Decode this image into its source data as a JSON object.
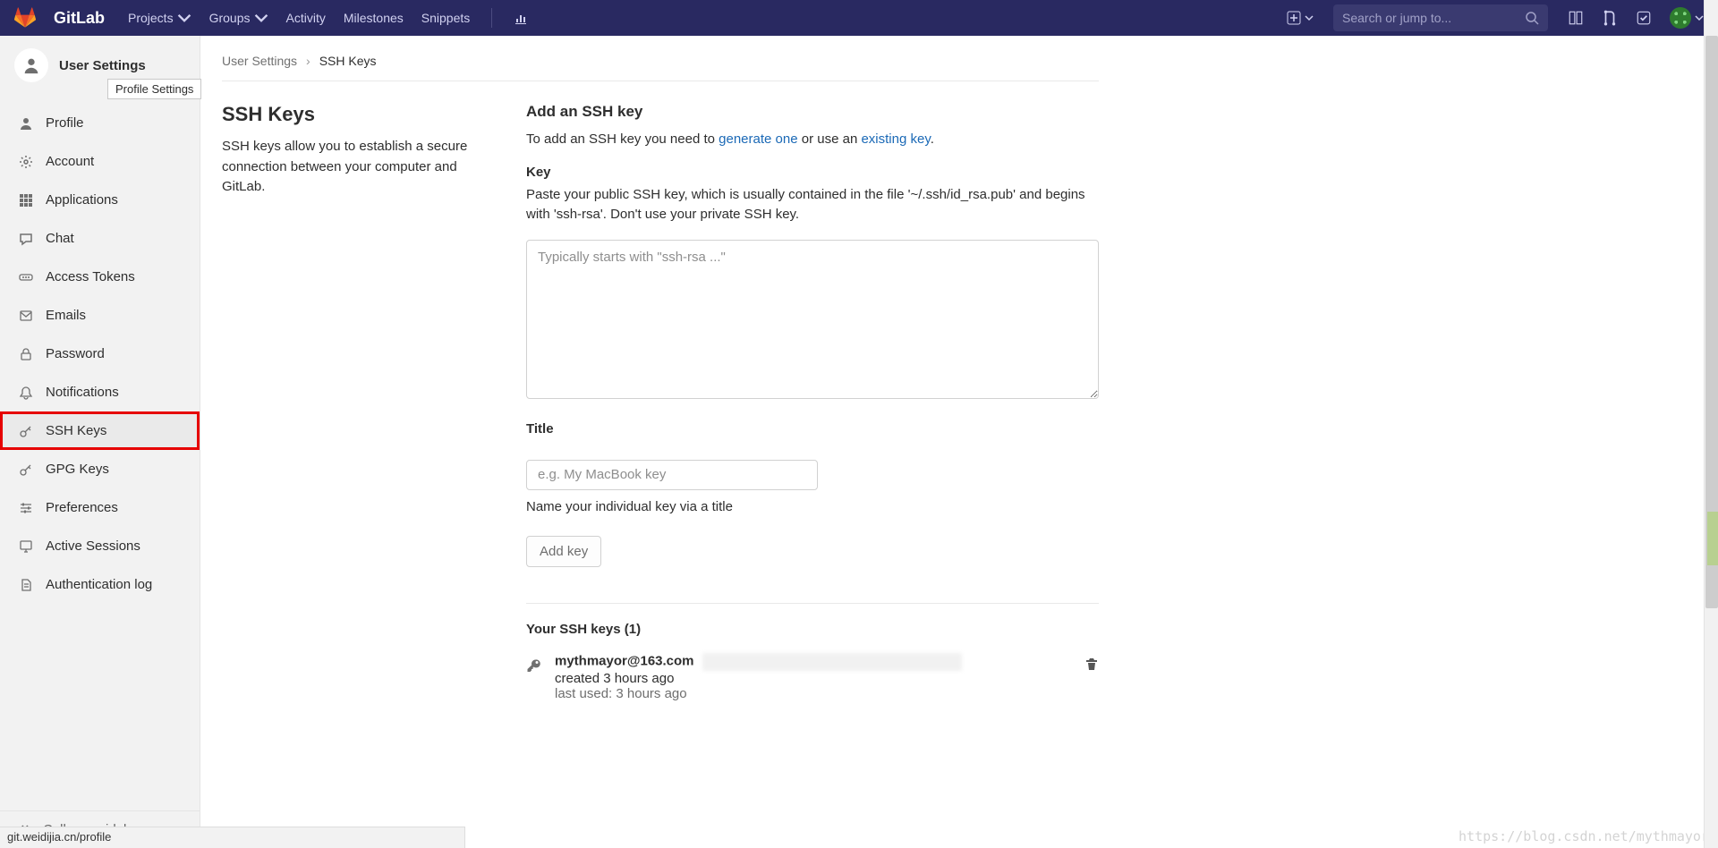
{
  "header": {
    "brand": "GitLab",
    "nav": {
      "projects": "Projects",
      "groups": "Groups",
      "activity": "Activity",
      "milestones": "Milestones",
      "snippets": "Snippets"
    },
    "search_placeholder": "Search or jump to..."
  },
  "sidebar": {
    "title": "User Settings",
    "tooltip": "Profile Settings",
    "items": [
      {
        "label": "Profile",
        "icon": "user"
      },
      {
        "label": "Account",
        "icon": "gear"
      },
      {
        "label": "Applications",
        "icon": "grid"
      },
      {
        "label": "Chat",
        "icon": "chat"
      },
      {
        "label": "Access Tokens",
        "icon": "dots"
      },
      {
        "label": "Emails",
        "icon": "mail"
      },
      {
        "label": "Password",
        "icon": "lock"
      },
      {
        "label": "Notifications",
        "icon": "bell"
      },
      {
        "label": "SSH Keys",
        "icon": "key",
        "active": true,
        "highlighted": true
      },
      {
        "label": "GPG Keys",
        "icon": "key"
      },
      {
        "label": "Preferences",
        "icon": "sliders"
      },
      {
        "label": "Active Sessions",
        "icon": "monitor"
      },
      {
        "label": "Authentication log",
        "icon": "doc"
      }
    ],
    "collapse": "Collapse sidebar"
  },
  "breadcrumbs": {
    "parent": "User Settings",
    "current": "SSH Keys"
  },
  "page": {
    "title": "SSH Keys",
    "desc": "SSH keys allow you to establish a secure connection between your computer and GitLab."
  },
  "add": {
    "heading": "Add an SSH key",
    "intro_pre": "To add an SSH key you need to ",
    "link_generate": "generate one",
    "intro_mid": " or use an ",
    "link_existing": "existing key",
    "intro_post": "."
  },
  "key_field": {
    "label": "Key",
    "hint": "Paste your public SSH key, which is usually contained in the file '~/.ssh/id_rsa.pub' and begins with 'ssh-rsa'. Don't use your private SSH key.",
    "placeholder": "Typically starts with \"ssh-rsa ...\""
  },
  "title_field": {
    "label": "Title",
    "placeholder": "e.g. My MacBook key",
    "helper": "Name your individual key via a title"
  },
  "add_button": "Add key",
  "keys_list": {
    "heading": "Your SSH keys (1)",
    "item": {
      "name": "mythmayor@163.com",
      "last_used_label": "last used: ",
      "last_used_value": "3 hours ago",
      "created": "created 3 hours ago"
    }
  },
  "status_bar": "git.weidijia.cn/profile",
  "watermark": "https://blog.csdn.net/mythmayor"
}
